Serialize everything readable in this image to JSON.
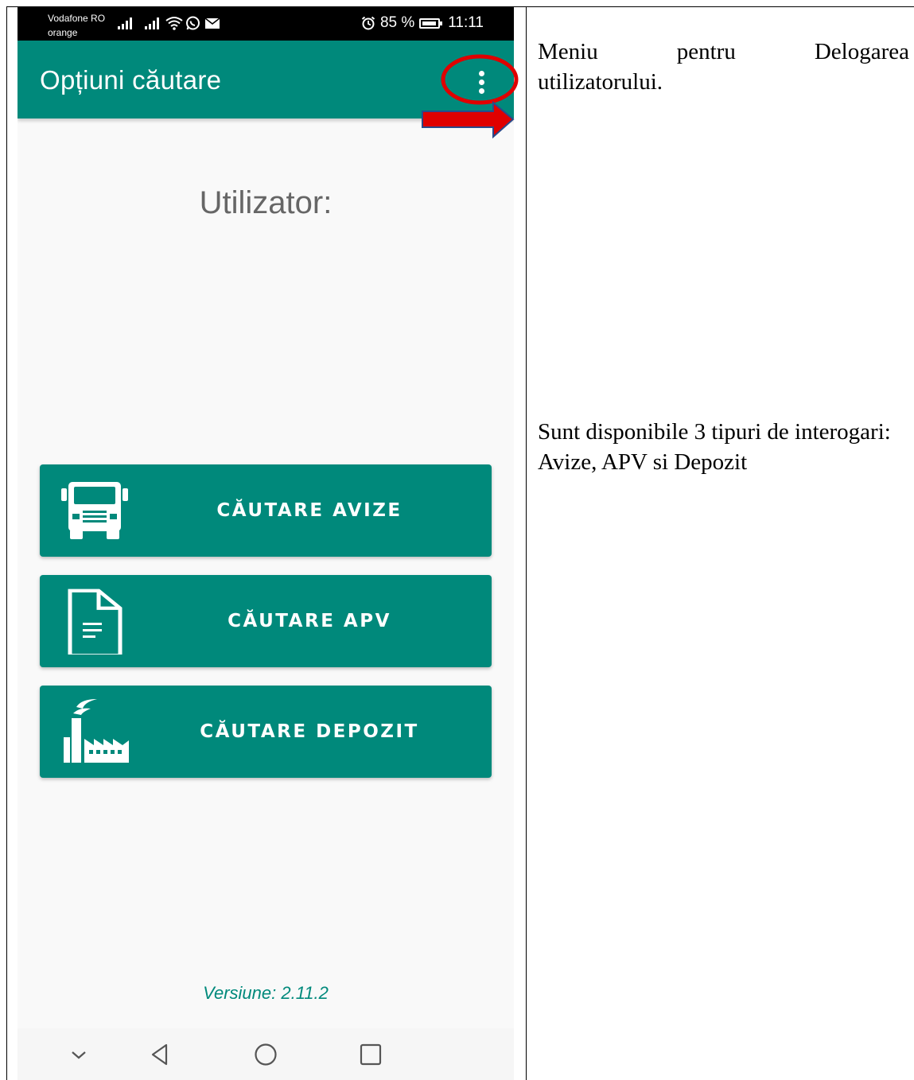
{
  "status_bar": {
    "carrier_1": "Vodafone RO",
    "carrier_2": "orange",
    "battery_percent": "85 %",
    "time": "11:11"
  },
  "app_bar": {
    "title": "Opțiuni căutare",
    "menu_icon": "more-vertical-icon"
  },
  "main": {
    "user_label": "Utilizator:",
    "buttons": [
      {
        "label": "CĂUTARE AVIZE",
        "icon": "truck-icon"
      },
      {
        "label": "CĂUTARE APV",
        "icon": "document-icon"
      },
      {
        "label": "CĂUTARE DEPOZIT",
        "icon": "factory-icon"
      }
    ],
    "version": "Versiune: 2.11.2"
  },
  "nav_bar": {
    "icons": [
      "chevron-down-icon",
      "back-icon",
      "home-icon",
      "recents-icon"
    ]
  },
  "annotations": {
    "menu_note_line1": "Meniu pentru Delogarea",
    "menu_note_line2": "utilizatorului.",
    "queries_note": "Sunt disponibile 3 tipuri de interogari: Avize, APV si Depozit"
  },
  "colors": {
    "primary": "#00897b",
    "highlight": "#e00000"
  }
}
